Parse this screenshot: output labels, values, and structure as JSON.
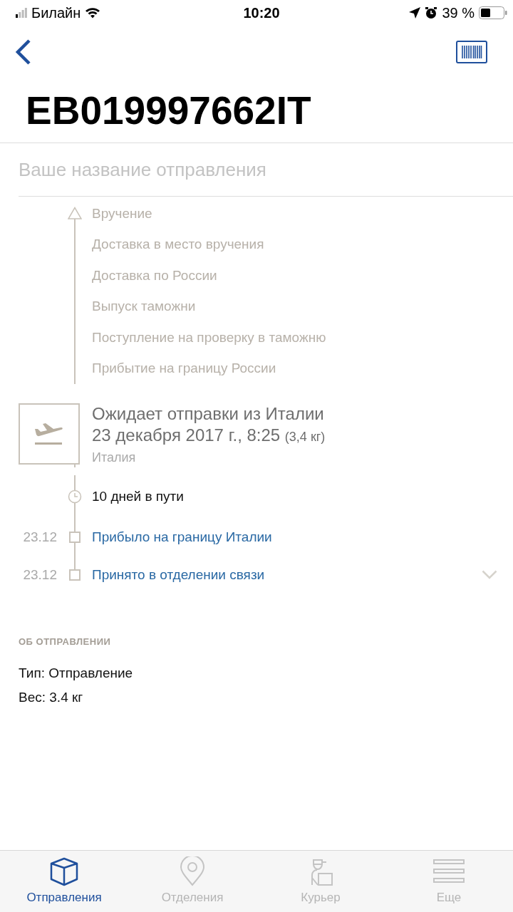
{
  "status_bar": {
    "carrier": "Билайн",
    "time": "10:20",
    "battery": "39 %"
  },
  "tracking_number": "EB019997662IT",
  "name_field": {
    "placeholder": "Ваше название отправления"
  },
  "timeline": {
    "upcoming": [
      "Вручение",
      "Доставка в место вручения",
      "Доставка по России",
      "Выпуск таможни",
      "Поступление на проверку в таможню",
      "Прибытие на границу России"
    ],
    "current": {
      "title": "Ожидает отправки из Италии",
      "date": "23 декабря 2017 г., 8:25",
      "weight": "(3,4 кг)",
      "place": "Италия"
    },
    "transit": "10 дней в пути",
    "events": [
      {
        "date": "23.12",
        "label": "Прибыло на границу Италии"
      },
      {
        "date": "23.12",
        "label": "Принято в отделении связи"
      }
    ]
  },
  "about": {
    "header": "ОБ ОТПРАВЛЕНИИ",
    "lines": [
      "Тип: Отправление",
      "Вес: 3.4 кг"
    ]
  },
  "tabs": [
    {
      "label": "Отправления",
      "selected": true,
      "kind": "box"
    },
    {
      "label": "Отделения",
      "selected": false,
      "kind": "pin"
    },
    {
      "label": "Курьер",
      "selected": false,
      "kind": "courier"
    },
    {
      "label": "Еще",
      "selected": false,
      "kind": "menu"
    }
  ]
}
